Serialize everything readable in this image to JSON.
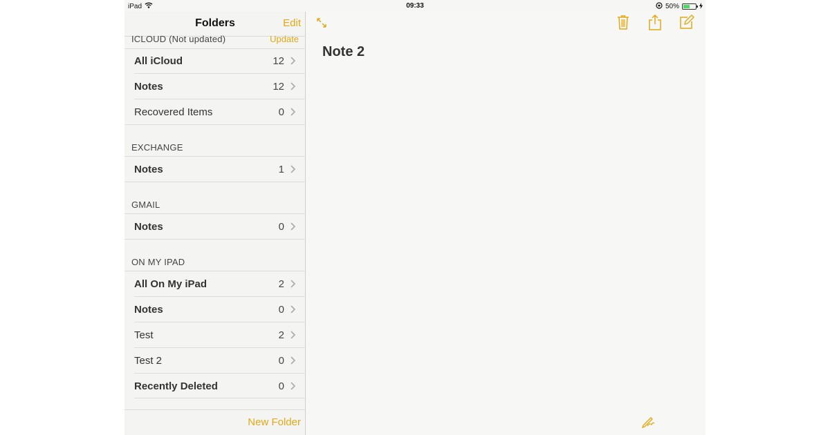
{
  "status_bar": {
    "device": "iPad",
    "time": "09:33",
    "battery": "50%",
    "battery_level": 0.5
  },
  "sidebar": {
    "title": "Folders",
    "edit_label": "Edit",
    "sections": [
      {
        "header": "ICLOUD (Not updated)",
        "action": "Update",
        "items": [
          {
            "label": "All iCloud",
            "count": "12",
            "bold": true
          },
          {
            "label": "Notes",
            "count": "12",
            "bold": true
          },
          {
            "label": "Recovered Items",
            "count": "0",
            "bold": false
          }
        ]
      },
      {
        "header": "EXCHANGE",
        "items": [
          {
            "label": "Notes",
            "count": "1",
            "bold": true
          }
        ]
      },
      {
        "header": "GMAIL",
        "items": [
          {
            "label": "Notes",
            "count": "0",
            "bold": true
          }
        ]
      },
      {
        "header": "ON MY IPAD",
        "items": [
          {
            "label": "All On My iPad",
            "count": "2",
            "bold": true
          },
          {
            "label": "Notes",
            "count": "0",
            "bold": true
          },
          {
            "label": "Test",
            "count": "2",
            "bold": false
          },
          {
            "label": "Test 2",
            "count": "0",
            "bold": false
          },
          {
            "label": "Recently Deleted",
            "count": "0",
            "bold": true
          }
        ]
      }
    ],
    "footer_label": "New Folder"
  },
  "note": {
    "title": "Note 2"
  },
  "colors": {
    "accent": "#e2a916",
    "background": "#f6f6f4"
  },
  "icons": {
    "expand": "expand-icon",
    "trash": "trash-icon",
    "share": "share-icon",
    "compose": "compose-icon",
    "sketch": "sketch-icon",
    "camera": "camera-icon"
  }
}
